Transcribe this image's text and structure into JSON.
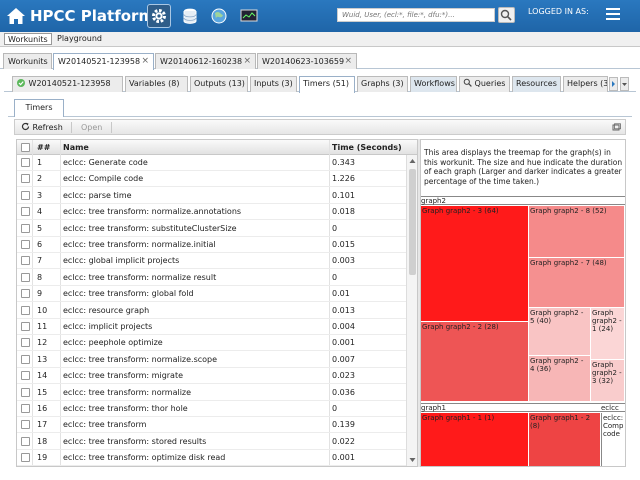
{
  "header": {
    "title": "HPCC Platform",
    "search_placeholder": "Wuid, User, (ecl:*, file:*, dfu:*)...",
    "logged_in": "LOGGED IN AS:"
  },
  "topnav": [
    "Workunits",
    "Playground"
  ],
  "wu_tabs": [
    "Workunits",
    "W20140521-123958",
    "W20140612-160238",
    "W20140623-103659"
  ],
  "sub_tabs": [
    "W20140521-123958",
    "Variables (8)",
    "Outputs (13)",
    "Inputs (3)",
    "Timers (51)",
    "Graphs (3)",
    "Workflows",
    "Queries",
    "Resources",
    "Helpers (3"
  ],
  "inner_tab": "Timers",
  "toolbar": {
    "refresh": "Refresh",
    "open": "Open"
  },
  "grid": {
    "columns": [
      "##",
      "Name",
      "Time (Seconds)"
    ],
    "rows": [
      [
        "1",
        "eclcc: Generate code",
        "0.343"
      ],
      [
        "2",
        "eclcc: Compile code",
        "1.226"
      ],
      [
        "3",
        "eclcc: parse time",
        "0.101"
      ],
      [
        "4",
        "eclcc: tree transform: normalize.annotations",
        "0.018"
      ],
      [
        "5",
        "eclcc: tree transform: substituteClusterSize",
        "0"
      ],
      [
        "6",
        "eclcc: tree transform: normalize.initial",
        "0.015"
      ],
      [
        "7",
        "eclcc: global implicit projects",
        "0.003"
      ],
      [
        "8",
        "eclcc: tree transform: normalize result",
        "0"
      ],
      [
        "9",
        "eclcc: tree transform: global fold",
        "0.01"
      ],
      [
        "10",
        "eclcc: resource graph",
        "0.013"
      ],
      [
        "11",
        "eclcc: implicit projects",
        "0.004"
      ],
      [
        "12",
        "eclcc: peephole optimize",
        "0.001"
      ],
      [
        "13",
        "eclcc: tree transform: normalize.scope",
        "0.007"
      ],
      [
        "14",
        "eclcc: tree transform: migrate",
        "0.023"
      ],
      [
        "15",
        "eclcc: tree transform: normalize",
        "0.036"
      ],
      [
        "16",
        "eclcc: tree transform: thor hole",
        "0"
      ],
      [
        "17",
        "eclcc: tree transform",
        "0.139"
      ],
      [
        "18",
        "eclcc: tree transform: stored results",
        "0.022"
      ],
      [
        "19",
        "eclcc: tree transform: optimize disk read",
        "0.001"
      ]
    ]
  },
  "treemap": {
    "description": "This area displays the treemap for the graph(s) in this workunit. The size and hue indicate the duration of each graph (Larger and darker indicates a greater percentage of the time taken.)",
    "groups": [
      "graph2",
      "graph1",
      "eclcc"
    ],
    "cells": [
      {
        "label": "Graph graph2 - 3 (64)",
        "color": "#ff1a1a"
      },
      {
        "label": "Graph graph2 - 8 (52)",
        "color": "#f58a8a"
      },
      {
        "label": "Graph graph2 - 7 (48)",
        "color": "#f59090"
      },
      {
        "label": "Graph graph2 - 2 (28)",
        "color": "#ee5555"
      },
      {
        "label": "Graph graph2 - 5 (40)",
        "color": "#f9c4c4"
      },
      {
        "label": "Graph graph2 - 1 (24)",
        "color": "#fbd6d6"
      },
      {
        "label": "Graph graph2 - 4 (36)",
        "color": "#f7b6b6"
      },
      {
        "label": "Graph graph2 - 3 (32)",
        "color": "#f9cccc"
      },
      {
        "label": "Graph graph1 - 1 (1)",
        "color": "#ff1a1a"
      },
      {
        "label": "Graph graph1 - 2 (8)",
        "color": "#ee4444"
      },
      {
        "label": "eclcc: Compile code",
        "color": "#ffffff"
      }
    ]
  },
  "colors": {
    "header": "#1f65a8",
    "accent": "#2a78bf"
  }
}
